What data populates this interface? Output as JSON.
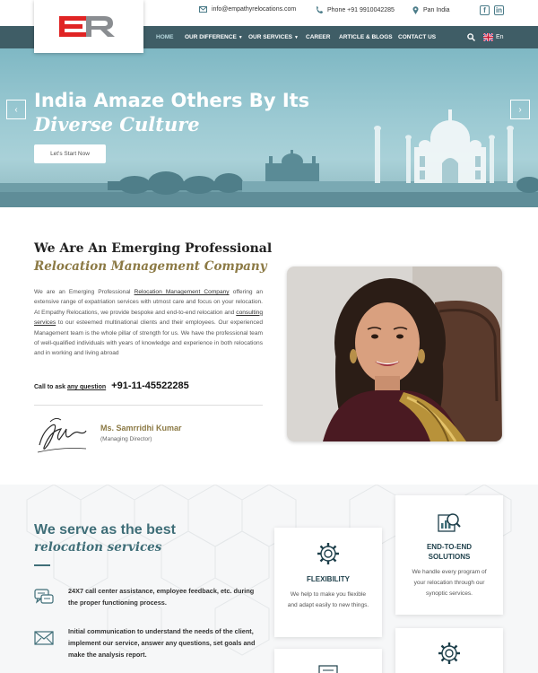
{
  "header": {
    "logo_text": "ER",
    "email": "info@empathyrelocations.com",
    "phone": "Phone +91 9910042285",
    "location": "Pan India",
    "social": [
      "facebook-icon",
      "linkedin-icon"
    ]
  },
  "nav": {
    "items": [
      {
        "label": "HOME",
        "active": true
      },
      {
        "label": "OUR DIFFERENCE",
        "has_dropdown": true
      },
      {
        "label": "OUR SERVICES",
        "has_dropdown": true
      },
      {
        "label": "CAREER"
      },
      {
        "label": "ARTICLE & BLOGS"
      },
      {
        "label": "CONTACT US"
      }
    ],
    "language": "En"
  },
  "hero": {
    "title_line1": "India Amaze Others By Its",
    "title_line2": "Diverse Culture",
    "button": "Let's Start Now"
  },
  "about": {
    "heading1": "We Are An Emerging Professional",
    "heading2": "Relocation Management Company",
    "para_1": "We are an Emerging Professional",
    "link_1": "Relocation Management Company",
    "para_2": "offering an extensive range of expatriation services with utmost care and focus on your relocation. At Empathy Relocations, we provide bespoke and end-to-end relocation and",
    "link_2": "consulting services",
    "para_3": "to our esteemed multinational clients and their employees. Our experienced Management team is the whole pillar of strength for us. We have the professional team of well-qualified individuals with years of knowledge and experience in both relocations and in working and living abroad",
    "call_prefix": "Call to ask",
    "call_link": "any question",
    "call_number": "+91-11-45522285",
    "person_name": "Ms. Samrridhi Kumar",
    "person_role": "(Managing Director)"
  },
  "services": {
    "heading1": "We serve as the best",
    "heading2": "relocation services",
    "items": [
      {
        "icon": "chat-icon",
        "text": "24X7 call center assistance, employee feedback, etc. during the proper functioning process."
      },
      {
        "icon": "envelope-icon",
        "text": "Initial communication to understand the needs of the client, implement our service, answer any questions, set goals and make the analysis report."
      }
    ],
    "cards": [
      {
        "icon": "gear-icon",
        "title": "FLEXIBILITY",
        "desc": "We help to make you flexible and adapt easily to new things."
      },
      {
        "icon": "analytics-icon",
        "title": "END-TO-END SOLUTIONS",
        "desc": "We handle every program of your relocation through our synoptic services."
      }
    ]
  },
  "colors": {
    "nav_bg": "#3f5d66",
    "accent_gold": "#8c7a45",
    "accent_teal": "#3f6e78",
    "logo_red": "#e02424"
  }
}
